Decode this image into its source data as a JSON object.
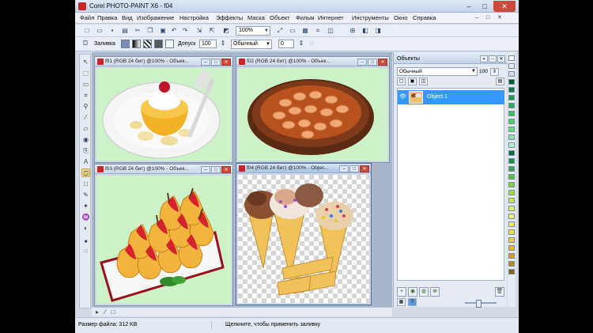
{
  "app": {
    "title": "Corel PHOTO-PAINT X6 - f04",
    "window_buttons": {
      "minimize": "‒",
      "maximize": "□",
      "close": "✕"
    }
  },
  "menu": {
    "items": [
      "Файл",
      "Правка",
      "Вид",
      "Изображение",
      "Настройка",
      "Эффекты",
      "Маска",
      "Объект",
      "Фильм",
      "Интернет",
      "Инструменты",
      "Окно",
      "Справка"
    ],
    "mdi_controls": "‒ □ ✕"
  },
  "toolbar": {
    "zoom": "100%"
  },
  "property_bar": {
    "fill_label": "Заливка",
    "tolerance_label": "Допуск",
    "tolerance_value": "100",
    "mode": "Обычный",
    "opacity": "0"
  },
  "documents": [
    {
      "title": "f01 (RGB 24 бит) @100% - Объек...",
      "image": "cake",
      "transparent": false,
      "active": false
    },
    {
      "title": "f02 (RGB 24 бит) @100% - Объек...",
      "image": "pie",
      "transparent": false,
      "active": false
    },
    {
      "title": "f03 (RGB 24 бит) @100% - Объек...",
      "image": "pears",
      "transparent": false,
      "active": false
    },
    {
      "title": "f04 (RGB 24 бит) @100% - Objec...",
      "image": "icecream",
      "transparent": true,
      "active": true
    }
  ],
  "objects_panel": {
    "title": "Объекты",
    "blend_mode": "Обычный",
    "opacity": "100",
    "objects": [
      {
        "name": "Object 1",
        "selected": true
      }
    ]
  },
  "palette": {
    "colors": [
      "#ffffff",
      "#f2f2f2",
      "#d9d9d9",
      "#0b5e2a",
      "#127a3a",
      "#1a9a48",
      "#23b354",
      "#2fc45c",
      "#47d16b",
      "#66dc84",
      "#8ee6a3",
      "#b5efc2",
      "#0c6e35",
      "#178f47",
      "#35a84f",
      "#5cbf45",
      "#7fcf3c",
      "#a3db3a",
      "#c6e84b",
      "#e0ef66",
      "#f0f07a",
      "#f5ec5c",
      "#f2de3c",
      "#efcf2a",
      "#e8b81f",
      "#d8a020",
      "#b8861a",
      "#8a6418"
    ]
  },
  "status": {
    "file_size": "Размер файла: 312 KB",
    "hint": "Щелкните, чтобы применить заливку"
  }
}
